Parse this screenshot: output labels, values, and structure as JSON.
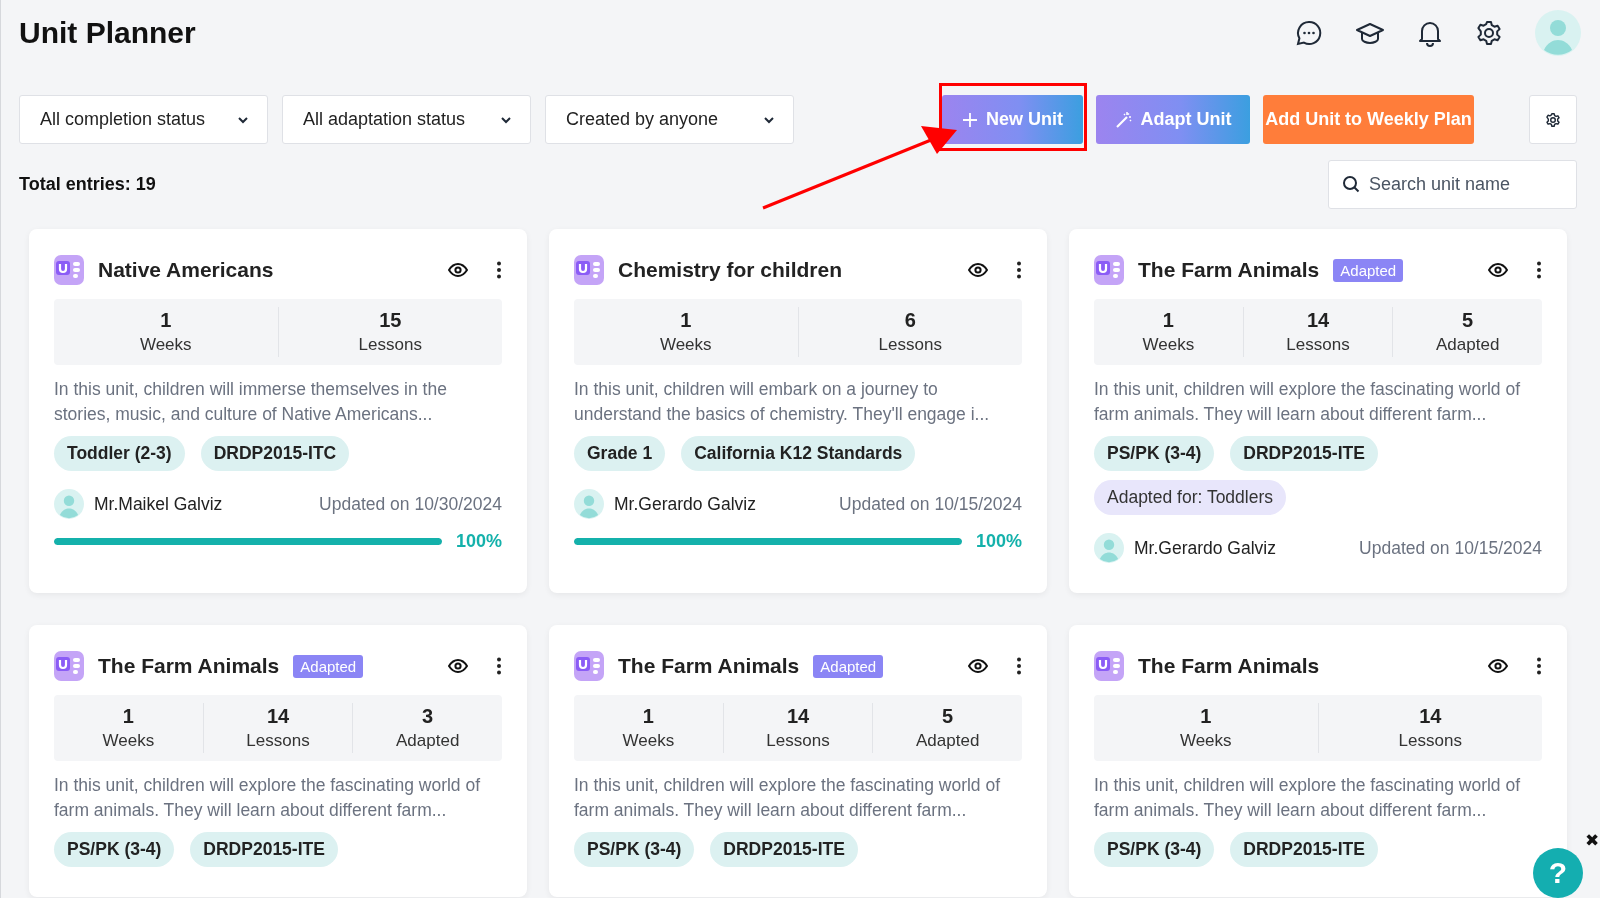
{
  "header": {
    "title": "Unit Planner"
  },
  "filters": [
    {
      "label": "All completion status"
    },
    {
      "label": "All adaptation status"
    },
    {
      "label": "Created by anyone"
    }
  ],
  "actions": [
    {
      "kind": "new",
      "label": "New Unit"
    },
    {
      "kind": "adapt",
      "label": "Adapt Unit"
    },
    {
      "kind": "weekly",
      "label": "Add Unit to Weekly Plan"
    }
  ],
  "total_entries": "Total entries: 19",
  "search": {
    "placeholder": "Search unit name"
  },
  "cards": [
    {
      "title": "Native Americans",
      "stats": [
        {
          "value": "1",
          "label": "Weeks"
        },
        {
          "value": "15",
          "label": "Lessons"
        }
      ],
      "description": "In this unit, children will immerse themselves in the stories, music, and culture of Native Americans...",
      "tags": [
        "Toddler (2-3)",
        "DRDP2015-ITC"
      ],
      "author": "Mr.Maikel Galviz",
      "updated": "Updated on 10/30/2024",
      "progress": {
        "level": 1,
        "reading": "100%"
      }
    },
    {
      "title": "Chemistry for children",
      "stats": [
        {
          "value": "1",
          "label": "Weeks"
        },
        {
          "value": "6",
          "label": "Lessons"
        }
      ],
      "description": "In this unit, children will embark on a journey to understand the basics of chemistry. They'll engage i...",
      "tags": [
        "Grade 1",
        "California K12 Standards"
      ],
      "author": "Mr.Gerardo Galviz",
      "updated": "Updated on 10/15/2024",
      "progress": {
        "level": 1,
        "reading": "100%"
      }
    },
    {
      "title": "The Farm Animals",
      "badge": "Adapted",
      "stats": [
        {
          "value": "1",
          "label": "Weeks"
        },
        {
          "value": "14",
          "label": "Lessons"
        },
        {
          "value": "5",
          "label": "Adapted"
        }
      ],
      "description": "In this unit, children will explore the fascinating world of farm animals. They will learn about different farm...",
      "tags": [
        "PS/PK (3-4)",
        "DRDP2015-ITE"
      ],
      "adapted_for": "Adapted for: Toddlers",
      "author": "Mr.Gerardo Galviz",
      "updated": "Updated on 10/15/2024"
    },
    {
      "title": "The Farm Animals",
      "badge": "Adapted",
      "stats": [
        {
          "value": "1",
          "label": "Weeks"
        },
        {
          "value": "14",
          "label": "Lessons"
        },
        {
          "value": "3",
          "label": "Adapted"
        }
      ],
      "description": "In this unit, children will explore the fascinating world of farm animals. They will learn about different farm...",
      "tags": [
        "PS/PK (3-4)",
        "DRDP2015-ITE"
      ]
    },
    {
      "title": "The Farm Animals",
      "badge": "Adapted",
      "stats": [
        {
          "value": "1",
          "label": "Weeks"
        },
        {
          "value": "14",
          "label": "Lessons"
        },
        {
          "value": "5",
          "label": "Adapted"
        }
      ],
      "description": "In this unit, children will explore the fascinating world of farm animals. They will learn about different farm...",
      "tags": [
        "PS/PK (3-4)",
        "DRDP2015-ITE"
      ]
    },
    {
      "title": "The Farm Animals",
      "stats": [
        {
          "value": "1",
          "label": "Weeks"
        },
        {
          "value": "14",
          "label": "Lessons"
        }
      ],
      "description": "In this unit, children will explore the fascinating world of farm animals. They will learn about different farm...",
      "tags": [
        "PS/PK (3-4)",
        "DRDP2015-ITE"
      ]
    }
  ],
  "help": {
    "label": "?",
    "close": "✖"
  }
}
